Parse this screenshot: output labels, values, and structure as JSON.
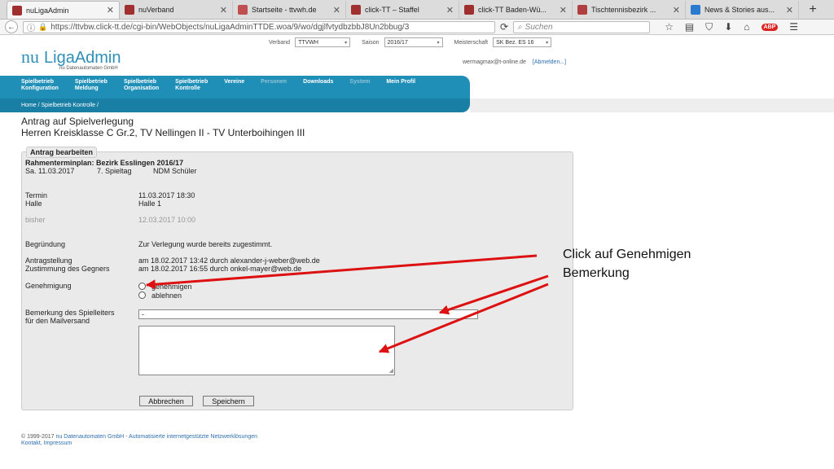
{
  "tabs": [
    {
      "label": "nuLigaAdmin",
      "active": true,
      "fav_color": "#a03030"
    },
    {
      "label": "nuVerband",
      "active": false,
      "fav_color": "#a03030"
    },
    {
      "label": "Startseite - ttvwh.de",
      "active": false,
      "fav_color": "#c05050"
    },
    {
      "label": "click-TT – Staffel",
      "active": false,
      "fav_color": "#a03030"
    },
    {
      "label": "click-TT Baden-Wü...",
      "active": false,
      "fav_color": "#a03030"
    },
    {
      "label": "Tischtennisbezirk ...",
      "active": false,
      "fav_color": "#b04040"
    },
    {
      "label": "News & Stories aus...",
      "active": false,
      "fav_color": "#2a7ad0"
    }
  ],
  "browser": {
    "url": "https://ttvbw.click-tt.de/cgi-bin/WebObjects/nuLigaAdminTTDE.woa/9/wo/dgjlfvtydbzbbJ8Un2bbug/3",
    "search_placeholder": "Suchen",
    "abp_label": "ABP"
  },
  "filters": {
    "verband_label": "Verband",
    "verband_value": "TTVWH",
    "saison_label": "Saison",
    "saison_value": "2016/17",
    "meisterschaft_label": "Meisterschaft",
    "meisterschaft_value": "SK Bez. ES 16"
  },
  "logo": {
    "nu": "nu",
    "name": "LigaAdmin",
    "sub": "nu Datenautomaten GmbH"
  },
  "user": {
    "email": "wermagmax@t-online.de",
    "logout": "[Abmelden...]"
  },
  "nav": [
    {
      "line1": "Spielbetrieb",
      "line2": "Konfiguration",
      "dim": false
    },
    {
      "line1": "Spielbetrieb",
      "line2": "Meldung",
      "dim": false
    },
    {
      "line1": "Spielbetrieb",
      "line2": "Organisation",
      "dim": false
    },
    {
      "line1": "Spielbetrieb",
      "line2": "Kontrolle",
      "dim": false
    },
    {
      "line1": "Vereine",
      "line2": "",
      "dim": false
    },
    {
      "line1": "Personen",
      "line2": "",
      "dim": true
    },
    {
      "line1": "Downloads",
      "line2": "",
      "dim": false
    },
    {
      "line1": "System",
      "line2": "",
      "dim": true
    },
    {
      "line1": "Mein Profil",
      "line2": "",
      "dim": false
    }
  ],
  "breadcrumb": "Home / Spielbetrieb Kontrolle /",
  "page": {
    "title": "Antrag auf Spielverlegung",
    "subtitle": "Herren Kreisklasse C Gr.2, TV Nellingen II - TV Unterboihingen III"
  },
  "form": {
    "legend": "Antrag bearbeiten",
    "rahmen": "Rahmenterminplan: Bezirk Esslingen 2016/17",
    "date": "Sa. 11.03.2017",
    "spieltag": "7. Spieltag",
    "ndm": "NDM Schüler",
    "termin_label": "Termin",
    "termin_value": "11.03.2017 18:30",
    "halle_label": "Halle",
    "halle_value": "Halle 1",
    "bisher_label": "bisher",
    "bisher_value": "12.03.2017 10:00",
    "begruendung_label": "Begründung",
    "begruendung_value": "Zur Verlegung wurde bereits zugestimmt.",
    "antrag_label": "Antragstellung",
    "antrag_value": "am 18.02.2017 13:42 durch alexander-j-weber@web.de",
    "zustimmung_label": "Zustimmung des Gegners",
    "zustimmung_value": "am 18.02.2017 16:55 durch onkel-mayer@web.de",
    "genehmigung_label": "Genehmigung",
    "opt_genehmigen": "genehmigen",
    "opt_ablehnen": "ablehnen",
    "bemerkung_label1": "Bemerkung des Spielleiters",
    "bemerkung_label2": "für den Mailversand",
    "bemerkung_value": "-",
    "cancel": "Abbrechen",
    "save": "Speichern"
  },
  "footer": {
    "copyright": "© 1999-2017",
    "company": "nu Datenautomaten GmbH - Automatisierte internetgestützte Netzwerklösungen",
    "links": "Kontakt, Impressum"
  },
  "annotation": {
    "line1": "Click auf Genehmigen",
    "line2": "Bemerkung",
    "arrow_color": "#dd1111"
  }
}
